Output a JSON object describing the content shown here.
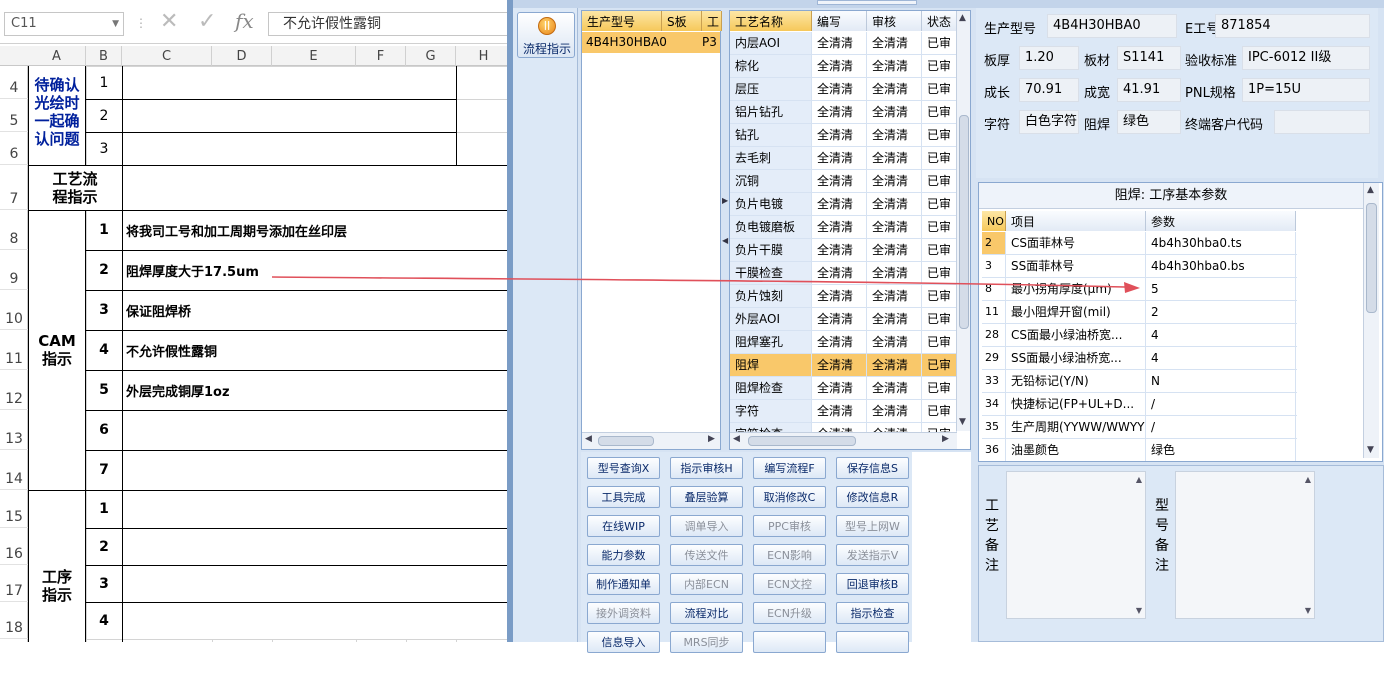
{
  "excel": {
    "name_box": "C11",
    "formula": "不允许假性露铜",
    "columns": [
      "A",
      "B",
      "C",
      "D",
      "E",
      "F",
      "G",
      "H"
    ],
    "row_numbers": [
      "4",
      "5",
      "6",
      "7",
      "8",
      "9",
      "10",
      "11",
      "12",
      "13",
      "14",
      "15",
      "16",
      "17",
      "18"
    ],
    "confirm_label": "待确认光绘时一起确认问题",
    "process_label": "工艺流程指示",
    "cam_label": "CAM指示",
    "step_label": "工序指示",
    "confirm_nums": [
      "1",
      "2",
      "3"
    ],
    "cam_nums": [
      "1",
      "2",
      "3",
      "4",
      "5",
      "6",
      "7"
    ],
    "cam_texts": [
      "将我司工号和加工周期号添加在丝印层",
      "阻焊厚度大于17.5um",
      "保证阻焊桥",
      "不允许假性露铜",
      "外层完成铜厚1oz",
      "",
      ""
    ],
    "step_nums": [
      "1",
      "2",
      "3",
      "4"
    ]
  },
  "app": {
    "side_button": "流程指示",
    "model_headers": [
      "生产型号",
      "S板",
      "工"
    ],
    "model_row": [
      "4B4H30HBA0",
      "P3"
    ],
    "process_headers": [
      "工艺名称",
      "编写",
      "审核",
      "状态"
    ],
    "process_rows": [
      {
        "name": "内层AOI",
        "w": "全清清",
        "r": "全清清",
        "s": "已审"
      },
      {
        "name": "棕化",
        "w": "全清清",
        "r": "全清清",
        "s": "已审"
      },
      {
        "name": "层压",
        "w": "全清清",
        "r": "全清清",
        "s": "已审"
      },
      {
        "name": "铝片钻孔",
        "w": "全清清",
        "r": "全清清",
        "s": "已审"
      },
      {
        "name": "钻孔",
        "w": "全清清",
        "r": "全清清",
        "s": "已审"
      },
      {
        "name": "去毛刺",
        "w": "全清清",
        "r": "全清清",
        "s": "已审"
      },
      {
        "name": "沉铜",
        "w": "全清清",
        "r": "全清清",
        "s": "已审"
      },
      {
        "name": "负片电镀",
        "w": "全清清",
        "r": "全清清",
        "s": "已审"
      },
      {
        "name": "负电镀磨板",
        "w": "全清清",
        "r": "全清清",
        "s": "已审"
      },
      {
        "name": "负片干膜",
        "w": "全清清",
        "r": "全清清",
        "s": "已审"
      },
      {
        "name": "干膜检查",
        "w": "全清清",
        "r": "全清清",
        "s": "已审"
      },
      {
        "name": "负片蚀刻",
        "w": "全清清",
        "r": "全清清",
        "s": "已审"
      },
      {
        "name": "外层AOI",
        "w": "全清清",
        "r": "全清清",
        "s": "已审"
      },
      {
        "name": "阻焊塞孔",
        "w": "全清清",
        "r": "全清清",
        "s": "已审"
      },
      {
        "name": "阻焊",
        "w": "全清清",
        "r": "全清清",
        "s": "已审"
      },
      {
        "name": "阻焊检查",
        "w": "全清清",
        "r": "全清清",
        "s": "已审"
      },
      {
        "name": "字符",
        "w": "全清清",
        "r": "全清清",
        "s": "已审"
      },
      {
        "name": "字符检查",
        "w": "全清清",
        "r": "全清清",
        "s": "已审"
      }
    ],
    "buttons": [
      [
        "型号查询X",
        "指示审核H",
        "编写流程F",
        "保存信息S"
      ],
      [
        "工具完成",
        "叠层验算",
        "取消修改C",
        "修改信息R"
      ],
      [
        "在线WIP",
        "调单导入",
        "PPC审核",
        "型号上网W"
      ],
      [
        "能力参数",
        "传送文件",
        "ECN影响",
        "发送指示V"
      ],
      [
        "制作通知单",
        "内部ECN",
        "ECN文控",
        "回退审核B"
      ],
      [
        "接外调资料",
        "流程对比",
        "ECN升级",
        "指示检查"
      ],
      [
        "信息导入",
        "MRS同步",
        "",
        ""
      ]
    ],
    "info": {
      "model_label": "生产型号",
      "model": "4B4H30HBA0",
      "eno_label": "E工号",
      "eno": "871854",
      "thick_label": "板厚",
      "thick": "1.20",
      "mat_label": "板材",
      "mat": "S1141",
      "std_label": "验收标准",
      "std": "IPC-6012 II级",
      "len_label": "成长",
      "len": "70.91",
      "wid_label": "成宽",
      "wid": "41.91",
      "pnl_label": "PNL规格",
      "pnl": "1P=15U",
      "char_label": "字符",
      "char": "白色字符",
      "mask_label": "阻焊",
      "mask": "绿色",
      "cust_label": "终端客户代码",
      "cust": ""
    },
    "param_title": "阻焊: 工序基本参数",
    "param_headers": [
      "NO",
      "项目",
      "参数"
    ],
    "params": [
      {
        "no": "2",
        "item": "CS面菲林号",
        "val": "4b4h30hba0.ts"
      },
      {
        "no": "3",
        "item": "SS面菲林号",
        "val": "4b4h30hba0.bs"
      },
      {
        "no": "8",
        "item": "最小拐角厚度(μm)",
        "val": "5"
      },
      {
        "no": "11",
        "item": "最小阻焊开窗(mil)",
        "val": "2"
      },
      {
        "no": "28",
        "item": "CS面最小绿油桥宽...",
        "val": "4"
      },
      {
        "no": "29",
        "item": "SS面最小绿油桥宽...",
        "val": "4"
      },
      {
        "no": "33",
        "item": "无铅标记(Y/N)",
        "val": "N"
      },
      {
        "no": "34",
        "item": "快捷标记(FP+UL+D...",
        "val": "/"
      },
      {
        "no": "35",
        "item": "生产周期(YYWW/WWYY)",
        "val": "/"
      },
      {
        "no": "36",
        "item": "油墨颜色",
        "val": "绿色"
      }
    ],
    "remark1": "工艺备注",
    "remark2": "型号备注"
  },
  "colors": {
    "accent": "#f6c85a",
    "panel": "#dbe6f4",
    "selected": "#f9c86a",
    "arrow": "#e0505a",
    "cam_text": "#000080"
  }
}
